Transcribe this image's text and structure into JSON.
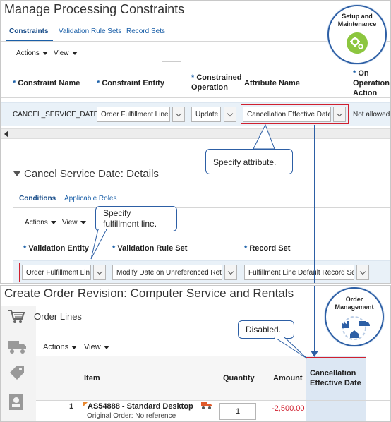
{
  "top": {
    "title": "Manage Processing Constraints",
    "tabs": [
      {
        "label": "Constraints",
        "active": true
      },
      {
        "label": "Validation Rule Sets",
        "active": false
      },
      {
        "label": "Record Sets",
        "active": false
      }
    ],
    "toolbar": {
      "actions": "Actions",
      "view": "View"
    },
    "badge": {
      "label_line1": "Setup and",
      "label_line2": "Maintenance",
      "icon": "gears-icon",
      "color": "#8cc63f"
    },
    "columns": [
      {
        "label": "Constraint Name",
        "required": true,
        "underlined": false
      },
      {
        "label": "Constraint Entity",
        "required": true,
        "underlined": true
      },
      {
        "label_line1": "Constrained",
        "label_line2": "Operation",
        "required": true
      },
      {
        "label": "Attribute Name",
        "required": false
      },
      {
        "label_line1": "On",
        "label_line2": "Operation",
        "label_line3": "Action",
        "required": true
      }
    ],
    "row": {
      "constraint_name": "CANCEL_SERVICE_DATE",
      "constraint_entity": "Order Fulfillment Line",
      "constrained_operation": "Update",
      "attribute_name": "Cancellation Effective Date",
      "on_operation_action": "Not allowed"
    },
    "callout_attribute": "Specify attribute.",
    "details": {
      "title": "Cancel Service Date: Details",
      "tabs": [
        {
          "label": "Conditions",
          "active": true
        },
        {
          "label": "Applicable Roles",
          "active": false
        }
      ],
      "toolbar": {
        "actions": "Actions",
        "view": "View"
      },
      "callout_line1": "Specify",
      "callout_line2": "fulfillment  line.",
      "columns": [
        {
          "label": "Validation Entity",
          "required": true
        },
        {
          "label": "Validation Rule Set",
          "required": true
        },
        {
          "label": "Record Set",
          "required": true
        }
      ],
      "row": {
        "validation_entity": "Order Fulfillment Line",
        "validation_rule_set": "Modify Date on Unreferenced Return",
        "record_set": "Fulfillment Line Default Record Set"
      }
    }
  },
  "bottom": {
    "title": "Create Order Revision: Computer Service and Rentals",
    "section": "Order Lines",
    "toolbar": {
      "actions": "Actions",
      "view": "View"
    },
    "badge": {
      "label_line1": "Order",
      "label_line2": "Management",
      "icon": "factory-truck-house-icon"
    },
    "callout": "Disabled.",
    "columns": {
      "item": "Item",
      "quantity": "Quantity",
      "amount": "Amount",
      "cancellation_line1": "Cancellation",
      "cancellation_line2": "Effective Date"
    },
    "line": {
      "number": "1",
      "item": "AS54888 - Standard Desktop",
      "original_order": "Original Order: No reference",
      "quantity": "1",
      "amount": "-2,500.00"
    }
  },
  "colors": {
    "accent": "#1a5fa8",
    "highlight": "#d0202f",
    "callout_border": "#2d5fa5",
    "negative_amount": "#d0202f"
  }
}
